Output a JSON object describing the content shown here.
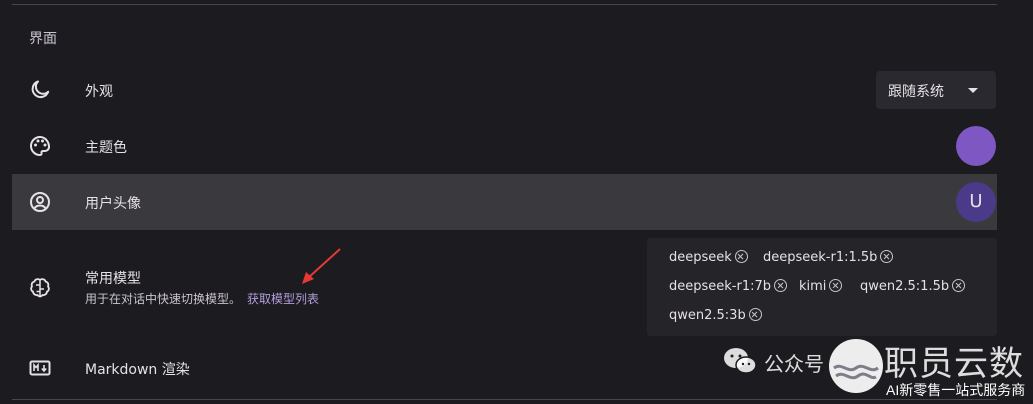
{
  "section": {
    "title": "界面"
  },
  "rows": {
    "appearance": {
      "label": "外观",
      "select_value": "跟随系统",
      "icon": "moon-icon"
    },
    "theme_color": {
      "label": "主题色",
      "color": "#7e57c2",
      "icon": "palette-icon"
    },
    "avatar": {
      "label": "用户头像",
      "initial": "U",
      "icon": "account-circle-icon"
    },
    "models": {
      "label": "常用模型",
      "description": "用于在对话中快速切换模型。",
      "link": "获取模型列表",
      "icon": "brain-icon",
      "chips": [
        "deepseek",
        "deepseek-r1:1.5b",
        "deepseek-r1:7b",
        "kimi",
        "qwen2.5:1.5b",
        "qwen2.5:3b"
      ]
    },
    "markdown": {
      "label": "Markdown 渲染",
      "icon": "markdown-icon"
    }
  },
  "watermark": {
    "wechat": "公众号",
    "brand": "职员云数",
    "slogan": "AI新零售一站式服务商"
  }
}
